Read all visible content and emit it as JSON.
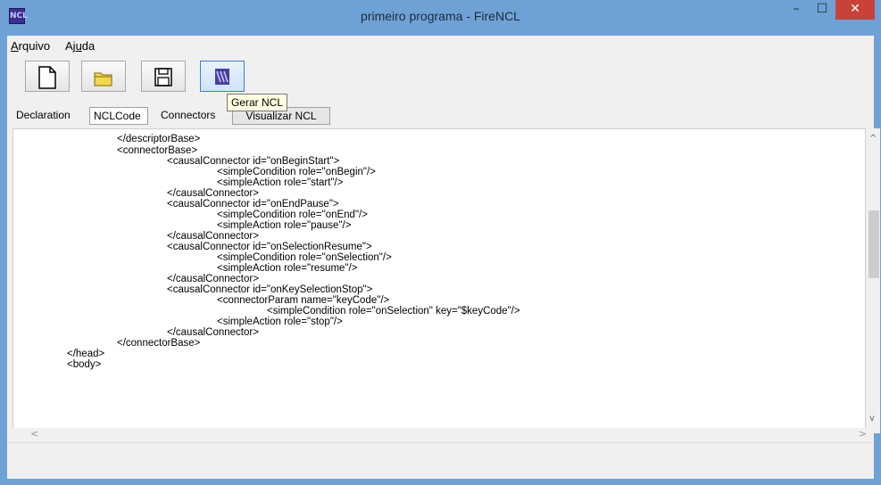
{
  "window": {
    "title": "primeiro programa - FireNCL",
    "icon_label": "NCL",
    "minimize_symbol": "–",
    "maximize_symbol": "☐",
    "close_symbol": "✕"
  },
  "menu": {
    "file_prefix": "",
    "file_underlined": "A",
    "file_rest": "rquivo",
    "help_prefix": "Aj",
    "help_underlined": "u",
    "help_rest": "da"
  },
  "toolbar": {
    "buttons": [
      "new-file-icon",
      "open-folder-icon",
      "save-icon",
      "generate-ncl-icon"
    ],
    "tooltip": "Gerar NCL"
  },
  "tabs": {
    "declaration": "Declaration",
    "nclcode": "NCLCode",
    "connectors": "Connectors",
    "visualizar": "Visualizar NCL"
  },
  "code": {
    "lines": [
      "</descriptorBase>",
      "<connectorBase>",
      "<causalConnector id=\"onBeginStart\">",
      "<simpleCondition role=\"onBegin\"/>",
      "<simpleAction role=\"start\"/>",
      "</causalConnector>",
      "<causalConnector id=\"onEndPause\">",
      "<simpleCondition role=\"onEnd\"/>",
      "<simpleAction role=\"pause\"/>",
      "</causalConnector>",
      "<causalConnector id=\"onSelectionResume\">",
      "<simpleCondition role=\"onSelection\"/>",
      "<simpleAction role=\"resume\"/>",
      "</causalConnector>",
      "<causalConnector id=\"onKeySelectionStop\">",
      "<connectorParam name=\"keyCode\"/>",
      "<simpleCondition role=\"onSelection\" key=\"$keyCode\"/>",
      "<simpleAction role=\"stop\"/>",
      "</causalConnector>",
      "</connectorBase>",
      "</head>",
      "<body>"
    ]
  },
  "scroll": {
    "up_arrow": "^",
    "down_arrow": "v",
    "left_arrow": "<",
    "right_arrow": ">"
  }
}
